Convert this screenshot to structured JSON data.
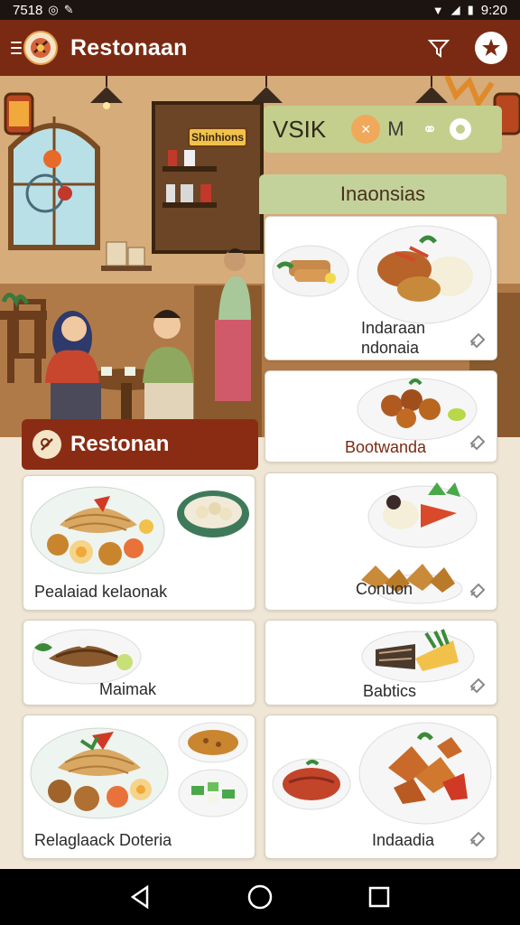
{
  "status_bar": {
    "time_left": "7518",
    "time_right": "9:20"
  },
  "app_bar": {
    "title": "Restonaan"
  },
  "hero": {
    "sign_text": "Shinhions",
    "banner": {
      "text": "VSIK",
      "badge_letter": "M"
    }
  },
  "right_column": {
    "header": "Inaonsias"
  },
  "left_column": {
    "label": "Restonan"
  },
  "cards": [
    {
      "label": "Indaraan\nndonaia"
    },
    {
      "label": "Bootwanda"
    },
    {
      "label": "Pealaiad kelaonak"
    },
    {
      "label": "Conuon"
    },
    {
      "label": "Maimak"
    },
    {
      "label": "Babtics"
    },
    {
      "label": "Relaglaack Doteria"
    },
    {
      "label": "Indaadia"
    }
  ],
  "colors": {
    "app_bar": "#7a2a12",
    "accent_green": "#c3d29a",
    "background": "#efe6d6"
  }
}
